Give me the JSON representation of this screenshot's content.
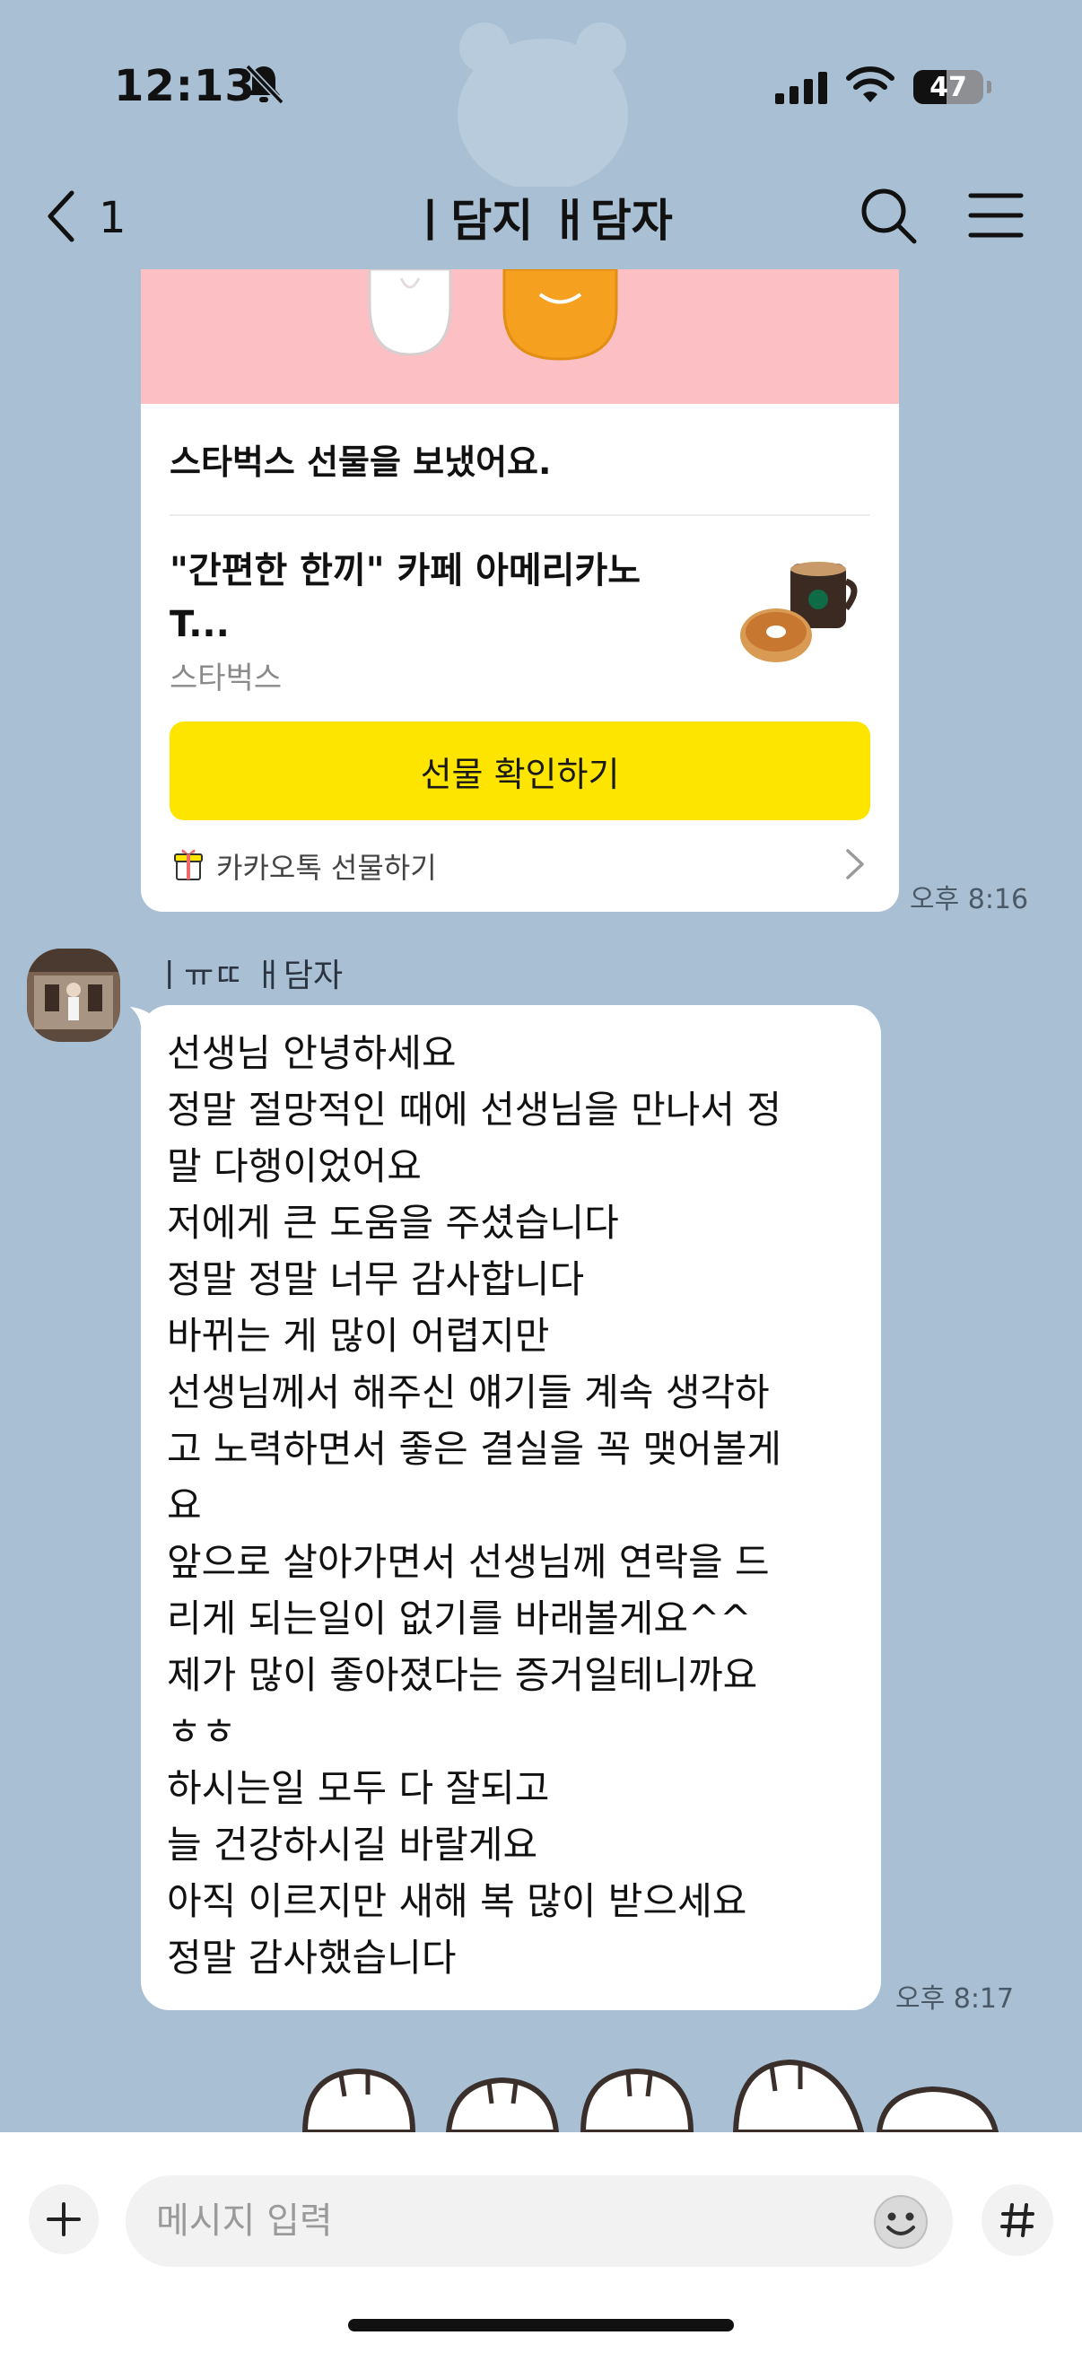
{
  "status_bar": {
    "time": "12:13",
    "battery_level": "47",
    "battery_fraction": 0.47,
    "icons": [
      "bell-off-icon",
      "signal-icon",
      "wifi-icon",
      "battery-icon"
    ]
  },
  "header": {
    "back_count": "1",
    "title": "ㅣ담지 ㅐ담자",
    "icons": [
      "back-chevron-icon",
      "search-icon",
      "menu-icon"
    ]
  },
  "gift_card": {
    "message": "스타벅스 선물을 보냈어요.",
    "product_name": "\"간편한 한끼\" 카페 아메리카노\nT...",
    "brand": "스타벅스",
    "button_label": "선물 확인하기",
    "footer_label": "카카오톡 선물하기",
    "time": "오후 8:16"
  },
  "received_message": {
    "sender": "ㅣㅠㄸ ㅐ담자",
    "text": "선생님 안녕하세요\n정말 절망적인 때에 선생님을 만나서 정\n말 다행이었어요\n저에게 큰 도움을 주셨습니다\n정말 정말 너무 감사합니다\n바뀌는 게 많이 어렵지만\n선생님께서 해주신 얘기들 계속 생각하\n고 노력하면서 좋은 결실을 꼭 맺어볼게\n요\n앞으로 살아가면서 선생님께 연락을 드\n리게 되는일이 없기를 바래볼게요^^\n제가 많이 좋아졌다는 증거일테니까요\nㅎㅎ\n하시는일 모두 다 잘되고\n늘 건강하시길 바랄게요\n아직 이르지만 새해 복 많이 받으세요\n정말 감사했습니다",
    "time": "오후 8:17"
  },
  "input_bar": {
    "placeholder": "메시지 입력",
    "value": "",
    "icons": [
      "plus-icon",
      "emoji-icon",
      "hash-icon"
    ]
  },
  "colors": {
    "chat_background": "#a9bfd3",
    "gift_button": "#fee500",
    "gift_banner": "#fcbfc3",
    "bubble": "#ffffff"
  }
}
